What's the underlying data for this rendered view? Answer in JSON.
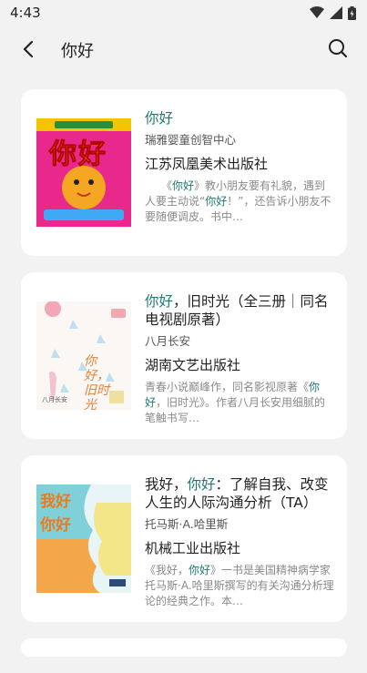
{
  "status_bar": {
    "time": "4:43"
  },
  "app_bar": {
    "title": "你好"
  },
  "books": [
    {
      "title_parts": [
        {
          "text": "你好",
          "hl": true
        }
      ],
      "author": "瑞雅婴童创智中心",
      "publisher": "江苏凤凰美术出版社",
      "desc_parts": [
        {
          "text": "　　《",
          "hl": false
        },
        {
          "text": "你好",
          "hl": true
        },
        {
          "text": "》教小朋友要有礼貌，遇到人要主动说“",
          "hl": false
        },
        {
          "text": "你好",
          "hl": true
        },
        {
          "text": "！”，还告诉小朋友不要随便调皮。书中…",
          "hl": false
        }
      ],
      "cover_text": "你好"
    },
    {
      "title_parts": [
        {
          "text": "你好",
          "hl": true
        },
        {
          "text": "，旧时光（全三册｜同名电视剧原著）",
          "hl": false
        }
      ],
      "author": "八月长安",
      "publisher": "湖南文艺出版社",
      "desc_parts": [
        {
          "text": "青春小说巅峰作，同名影视原著《",
          "hl": false
        },
        {
          "text": "你好",
          "hl": true
        },
        {
          "text": "，旧时光》。作者八月长安用细腻的笔触书写…",
          "hl": false
        }
      ],
      "cover_text": "你好，旧时光"
    },
    {
      "title_parts": [
        {
          "text": "我好，",
          "hl": false
        },
        {
          "text": "你好",
          "hl": true
        },
        {
          "text": "：了解自我、改变人生的人际沟通分析（TA）",
          "hl": false
        }
      ],
      "author": "托马斯·A.哈里斯",
      "publisher": "机械工业出版社",
      "desc_parts": [
        {
          "text": "《我好，",
          "hl": false
        },
        {
          "text": "你好",
          "hl": true
        },
        {
          "text": "》一书是美国精神病学家托马斯·A.哈里斯撰写的有关沟通分析理论的经典之作。本…",
          "hl": false
        }
      ],
      "cover_text": "我好 你好"
    }
  ]
}
